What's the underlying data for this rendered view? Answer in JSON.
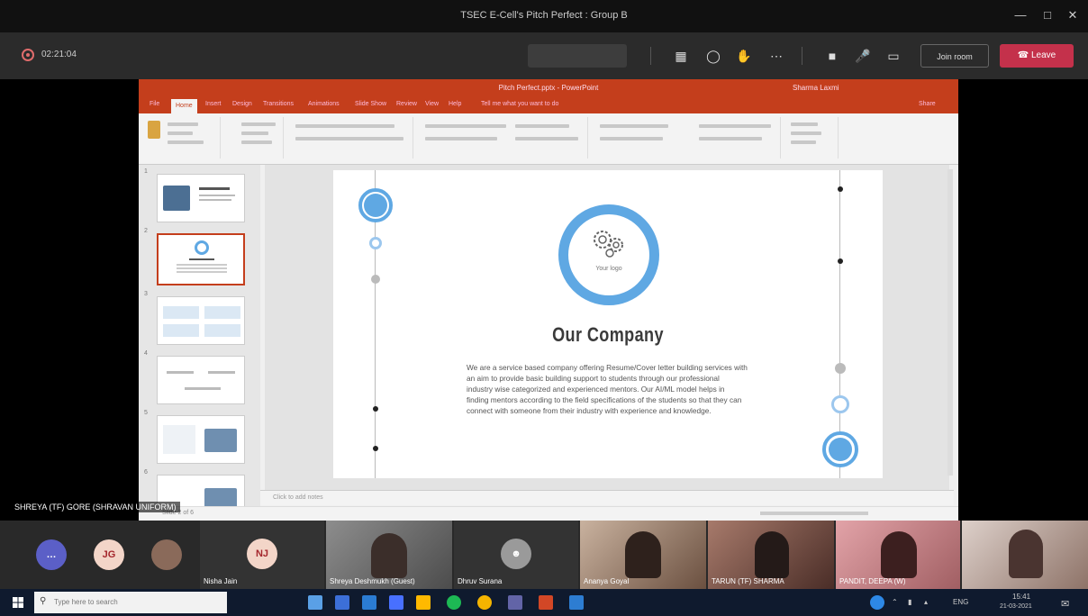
{
  "window": {
    "title": "TSEC E-Cell's Pitch Perfect : Group B"
  },
  "meeting": {
    "timer": "02:21:04",
    "share_pill": "",
    "join_label": "Join room",
    "leave_label": "Leave"
  },
  "powerpoint": {
    "doc_title": "Pitch Perfect.pptx - PowerPoint",
    "user": "Sharma Laxmi",
    "tabs": [
      "File",
      "Home",
      "Insert",
      "Design",
      "Transitions",
      "Animations",
      "Slide Show",
      "Review",
      "View",
      "Help"
    ],
    "tell_me": "Tell me what you want to do",
    "share": "Share",
    "notes_placeholder": "Click to add notes",
    "status": "Slide 2 of 6"
  },
  "slide": {
    "logo_text": "Your logo",
    "title": "Our Company",
    "body": "We are a service based company offering Resume/Cover letter building services with an aim to provide basic building support to students through our professional industry wise categorized and experienced mentors. Our AI/ML model helps in finding mentors according to the field specifications of the students so that they can connect with someone from their industry with experience and knowledge."
  },
  "presenter_tag": "SHREYA (TF) GORE (SHRAVAN UNIFORM)",
  "participants": [
    {
      "kind": "avatar",
      "initials": "",
      "color": "#5b5fc7"
    },
    {
      "kind": "avatar",
      "initials": "JG",
      "color": "#f3d5c8"
    },
    {
      "kind": "avatar",
      "initials": "",
      "color": "#8a6a5a"
    },
    {
      "kind": "avatar-tile",
      "initials": "NJ",
      "color": "#f3d5c8",
      "label": "Nisha Jain"
    },
    {
      "kind": "video",
      "label": "Shreya Deshmukh (Guest)",
      "color": "#6e6e6e"
    },
    {
      "kind": "avatar-tile",
      "initials": "",
      "color": "#9a9a9a",
      "label": "Dhruv Surana"
    },
    {
      "kind": "video",
      "label": "Ananya Goyal",
      "color": "#8b6b58"
    },
    {
      "kind": "video",
      "label": "TARUN (TF) SHARMA",
      "color": "#7a5046"
    },
    {
      "kind": "video",
      "label": "PANDIT, DEEPA (W)",
      "color": "#b77c7a"
    },
    {
      "kind": "video",
      "label": "",
      "color": "#a58e86"
    }
  ],
  "taskbar": {
    "search_placeholder": "Type here to search",
    "lang": "ENG",
    "time": "15:41",
    "date": "21-03-2021"
  },
  "colors": {
    "ppt_red": "#c43e1c",
    "logo_blue": "#5fa8e3",
    "leave_red": "#c4314b"
  }
}
